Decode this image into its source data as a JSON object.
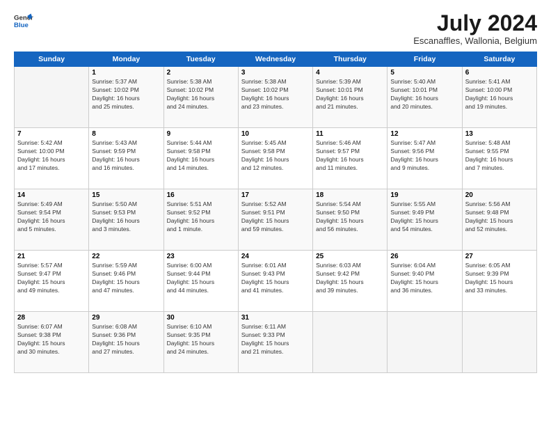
{
  "logo": {
    "general": "General",
    "blue": "Blue"
  },
  "title": {
    "month_year": "July 2024",
    "location": "Escanaffles, Wallonia, Belgium"
  },
  "days_of_week": [
    "Sunday",
    "Monday",
    "Tuesday",
    "Wednesday",
    "Thursday",
    "Friday",
    "Saturday"
  ],
  "weeks": [
    [
      {
        "day": "",
        "info": ""
      },
      {
        "day": "1",
        "info": "Sunrise: 5:37 AM\nSunset: 10:02 PM\nDaylight: 16 hours\nand 25 minutes."
      },
      {
        "day": "2",
        "info": "Sunrise: 5:38 AM\nSunset: 10:02 PM\nDaylight: 16 hours\nand 24 minutes."
      },
      {
        "day": "3",
        "info": "Sunrise: 5:38 AM\nSunset: 10:02 PM\nDaylight: 16 hours\nand 23 minutes."
      },
      {
        "day": "4",
        "info": "Sunrise: 5:39 AM\nSunset: 10:01 PM\nDaylight: 16 hours\nand 21 minutes."
      },
      {
        "day": "5",
        "info": "Sunrise: 5:40 AM\nSunset: 10:01 PM\nDaylight: 16 hours\nand 20 minutes."
      },
      {
        "day": "6",
        "info": "Sunrise: 5:41 AM\nSunset: 10:00 PM\nDaylight: 16 hours\nand 19 minutes."
      }
    ],
    [
      {
        "day": "7",
        "info": "Sunrise: 5:42 AM\nSunset: 10:00 PM\nDaylight: 16 hours\nand 17 minutes."
      },
      {
        "day": "8",
        "info": "Sunrise: 5:43 AM\nSunset: 9:59 PM\nDaylight: 16 hours\nand 16 minutes."
      },
      {
        "day": "9",
        "info": "Sunrise: 5:44 AM\nSunset: 9:58 PM\nDaylight: 16 hours\nand 14 minutes."
      },
      {
        "day": "10",
        "info": "Sunrise: 5:45 AM\nSunset: 9:58 PM\nDaylight: 16 hours\nand 12 minutes."
      },
      {
        "day": "11",
        "info": "Sunrise: 5:46 AM\nSunset: 9:57 PM\nDaylight: 16 hours\nand 11 minutes."
      },
      {
        "day": "12",
        "info": "Sunrise: 5:47 AM\nSunset: 9:56 PM\nDaylight: 16 hours\nand 9 minutes."
      },
      {
        "day": "13",
        "info": "Sunrise: 5:48 AM\nSunset: 9:55 PM\nDaylight: 16 hours\nand 7 minutes."
      }
    ],
    [
      {
        "day": "14",
        "info": "Sunrise: 5:49 AM\nSunset: 9:54 PM\nDaylight: 16 hours\nand 5 minutes."
      },
      {
        "day": "15",
        "info": "Sunrise: 5:50 AM\nSunset: 9:53 PM\nDaylight: 16 hours\nand 3 minutes."
      },
      {
        "day": "16",
        "info": "Sunrise: 5:51 AM\nSunset: 9:52 PM\nDaylight: 16 hours\nand 1 minute."
      },
      {
        "day": "17",
        "info": "Sunrise: 5:52 AM\nSunset: 9:51 PM\nDaylight: 15 hours\nand 59 minutes."
      },
      {
        "day": "18",
        "info": "Sunrise: 5:54 AM\nSunset: 9:50 PM\nDaylight: 15 hours\nand 56 minutes."
      },
      {
        "day": "19",
        "info": "Sunrise: 5:55 AM\nSunset: 9:49 PM\nDaylight: 15 hours\nand 54 minutes."
      },
      {
        "day": "20",
        "info": "Sunrise: 5:56 AM\nSunset: 9:48 PM\nDaylight: 15 hours\nand 52 minutes."
      }
    ],
    [
      {
        "day": "21",
        "info": "Sunrise: 5:57 AM\nSunset: 9:47 PM\nDaylight: 15 hours\nand 49 minutes."
      },
      {
        "day": "22",
        "info": "Sunrise: 5:59 AM\nSunset: 9:46 PM\nDaylight: 15 hours\nand 47 minutes."
      },
      {
        "day": "23",
        "info": "Sunrise: 6:00 AM\nSunset: 9:44 PM\nDaylight: 15 hours\nand 44 minutes."
      },
      {
        "day": "24",
        "info": "Sunrise: 6:01 AM\nSunset: 9:43 PM\nDaylight: 15 hours\nand 41 minutes."
      },
      {
        "day": "25",
        "info": "Sunrise: 6:03 AM\nSunset: 9:42 PM\nDaylight: 15 hours\nand 39 minutes."
      },
      {
        "day": "26",
        "info": "Sunrise: 6:04 AM\nSunset: 9:40 PM\nDaylight: 15 hours\nand 36 minutes."
      },
      {
        "day": "27",
        "info": "Sunrise: 6:05 AM\nSunset: 9:39 PM\nDaylight: 15 hours\nand 33 minutes."
      }
    ],
    [
      {
        "day": "28",
        "info": "Sunrise: 6:07 AM\nSunset: 9:38 PM\nDaylight: 15 hours\nand 30 minutes."
      },
      {
        "day": "29",
        "info": "Sunrise: 6:08 AM\nSunset: 9:36 PM\nDaylight: 15 hours\nand 27 minutes."
      },
      {
        "day": "30",
        "info": "Sunrise: 6:10 AM\nSunset: 9:35 PM\nDaylight: 15 hours\nand 24 minutes."
      },
      {
        "day": "31",
        "info": "Sunrise: 6:11 AM\nSunset: 9:33 PM\nDaylight: 15 hours\nand 21 minutes."
      },
      {
        "day": "",
        "info": ""
      },
      {
        "day": "",
        "info": ""
      },
      {
        "day": "",
        "info": ""
      }
    ]
  ]
}
